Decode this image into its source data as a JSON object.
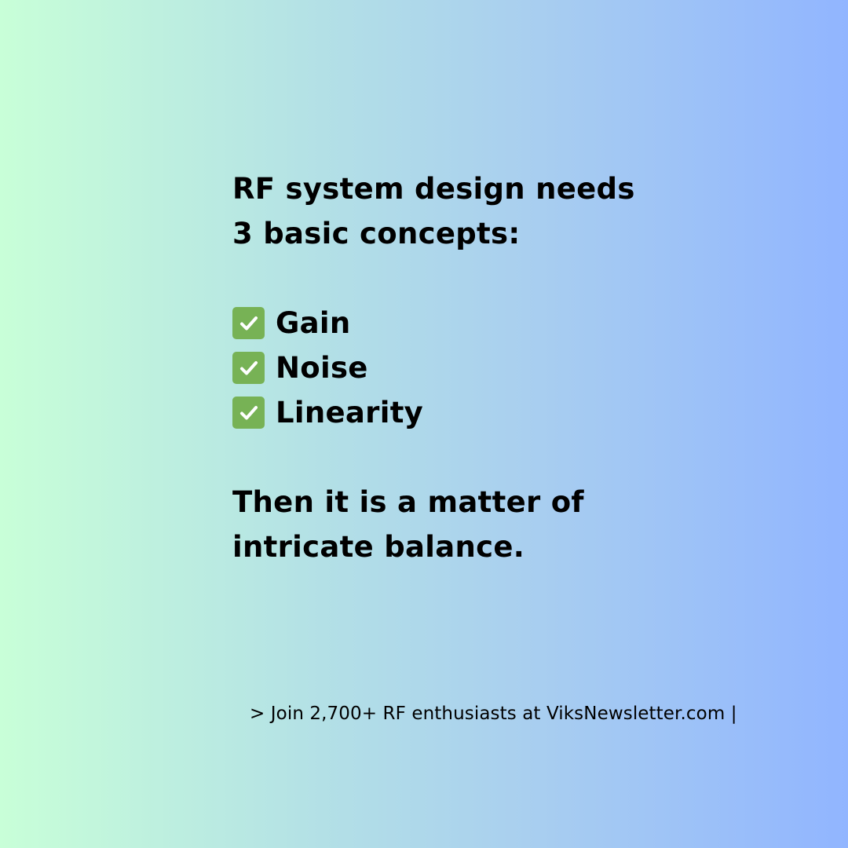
{
  "headline": {
    "line1": "RF system design needs",
    "line2": "3 basic concepts:"
  },
  "concepts": [
    {
      "icon": "check-mark-icon",
      "label": "Gain"
    },
    {
      "icon": "check-mark-icon",
      "label": "Noise"
    },
    {
      "icon": "check-mark-icon",
      "label": "Linearity"
    }
  ],
  "closing": {
    "line1": "Then it is a matter of",
    "line2": "intricate balance."
  },
  "footer": {
    "text": "> Join 2,700+ RF enthusiasts at ViksNewsletter.com |"
  },
  "colors": {
    "gradient_start": "#c8ffd8",
    "gradient_end": "#91b5ff",
    "check_box": "#77b255",
    "text": "#000000"
  }
}
